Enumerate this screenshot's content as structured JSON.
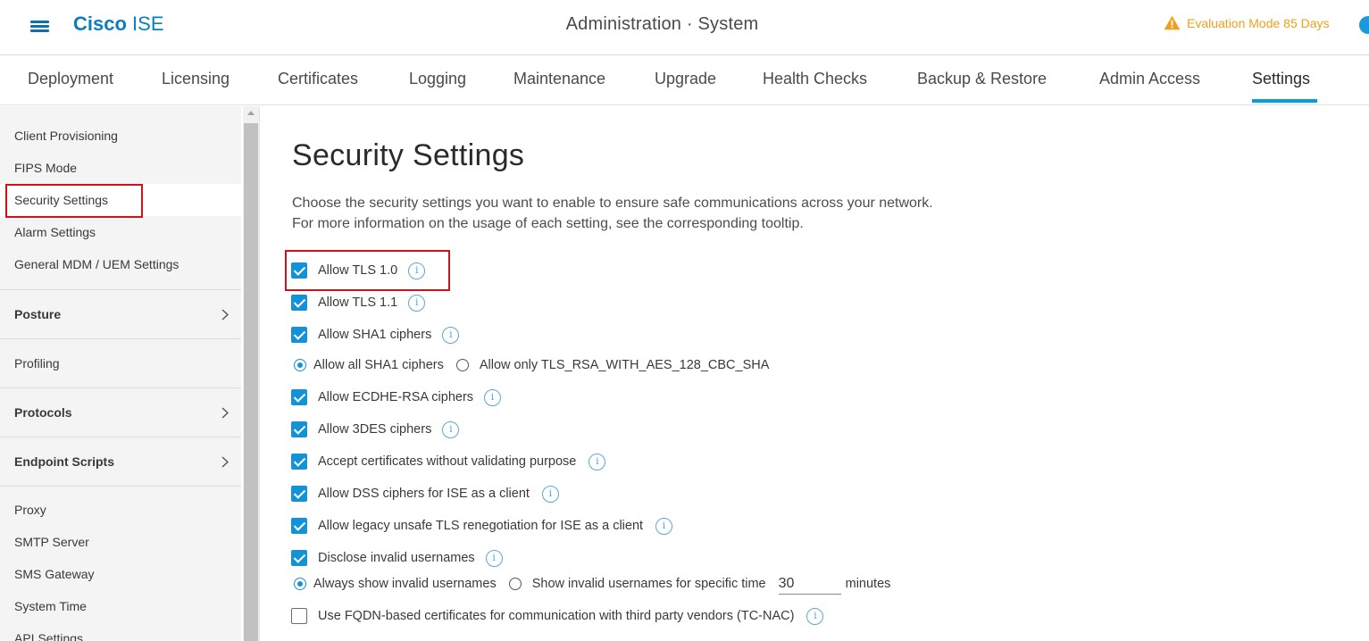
{
  "header": {
    "brand_bold": "Cisco",
    "brand_light": "ISE",
    "title": "Administration · System",
    "evaluation": "Evaluation Mode 85 Days",
    "accent": "#049fd9",
    "warning_color": "#f0a019"
  },
  "tabs": [
    {
      "label": "Deployment"
    },
    {
      "label": "Licensing"
    },
    {
      "label": "Certificates"
    },
    {
      "label": "Logging"
    },
    {
      "label": "Maintenance"
    },
    {
      "label": "Upgrade"
    },
    {
      "label": "Health Checks"
    },
    {
      "label": "Backup & Restore"
    },
    {
      "label": "Admin Access"
    },
    {
      "label": "Settings",
      "active": true
    }
  ],
  "sidebar": {
    "items": [
      {
        "label": "Client Provisioning"
      },
      {
        "label": "FIPS Mode"
      },
      {
        "label": "Security Settings",
        "selected": true
      },
      {
        "label": "Alarm Settings"
      },
      {
        "label": "General MDM / UEM Settings"
      }
    ],
    "groups": [
      {
        "label": "Posture"
      },
      {
        "label": "Profiling"
      },
      {
        "label": "Protocols"
      },
      {
        "label": "Endpoint Scripts"
      }
    ],
    "items2": [
      {
        "label": "Proxy"
      },
      {
        "label": "SMTP Server"
      },
      {
        "label": "SMS Gateway"
      },
      {
        "label": "System Time"
      },
      {
        "label": "API Settings"
      }
    ]
  },
  "main": {
    "title": "Security Settings",
    "description": "Choose the security settings you want to enable to ensure safe communications across your network. For more information on the usage of each setting, see the corresponding tooltip.",
    "options": {
      "tls10": {
        "label": "Allow TLS 1.0",
        "checked": true
      },
      "tls11": {
        "label": "Allow TLS 1.1",
        "checked": true
      },
      "sha1": {
        "label": "Allow SHA1 ciphers",
        "checked": true
      },
      "sha1_all": {
        "label": "Allow all SHA1 ciphers",
        "selected": true
      },
      "sha1_only": {
        "label": "Allow only TLS_RSA_WITH_AES_128_CBC_SHA",
        "selected": false
      },
      "ecdhe": {
        "label": "Allow ECDHE-RSA ciphers",
        "checked": true
      },
      "des3": {
        "label": "Allow 3DES ciphers",
        "checked": true
      },
      "accept_certs": {
        "label": "Accept certificates without validating purpose",
        "checked": true
      },
      "dss": {
        "label": "Allow DSS ciphers for ISE as a client",
        "checked": true
      },
      "legacy": {
        "label": "Allow legacy unsafe TLS renegotiation for ISE as a client",
        "checked": true
      },
      "disclose": {
        "label": "Disclose invalid usernames",
        "checked": true
      },
      "always_show": {
        "label": "Always show invalid usernames",
        "selected": true
      },
      "show_time": {
        "label": "Show invalid usernames for specific time",
        "selected": false
      },
      "minutes_value": "30",
      "minutes_unit": "minutes",
      "fqdn": {
        "label": "Use FQDN-based certificates for communication with third party vendors (TC-NAC)",
        "checked": false
      }
    },
    "info_glyph": "i"
  }
}
